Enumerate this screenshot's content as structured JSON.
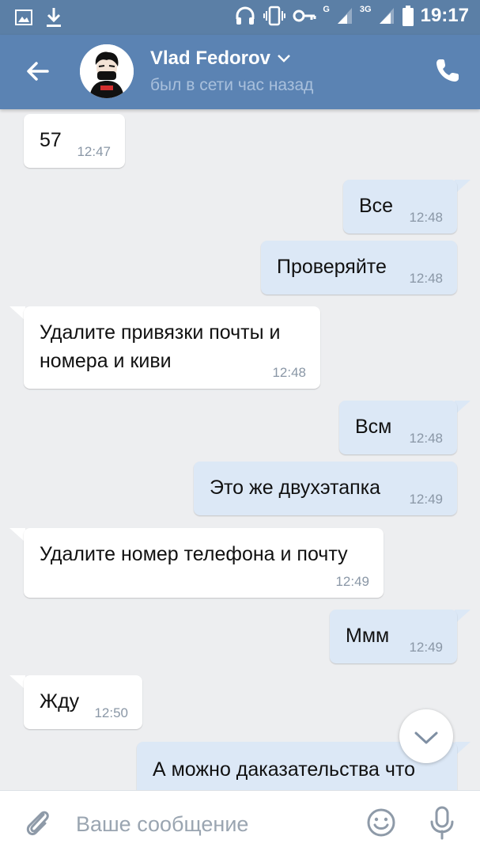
{
  "status_bar": {
    "time": "19:17",
    "network_1": "G",
    "network_2": "3G",
    "icons": [
      "image-icon",
      "download-icon",
      "headset-icon",
      "vibrate-icon",
      "key-icon",
      "signal-icon",
      "signal-icon",
      "battery-icon"
    ]
  },
  "header": {
    "contact_name": "Vlad Fedorov",
    "last_seen": "был в сети час назад",
    "icons": [
      "back-arrow-icon",
      "chevron-down-icon",
      "phone-icon"
    ]
  },
  "messages": [
    {
      "direction": "in",
      "text": "57",
      "time": "12:47"
    },
    {
      "direction": "out",
      "text": "Все",
      "time": "12:48"
    },
    {
      "direction": "out",
      "text": "Проверяйте",
      "time": "12:48"
    },
    {
      "direction": "in",
      "text_lines": [
        "Удалите привязки почты и",
        "номера и киви"
      ],
      "time": "12:48"
    },
    {
      "direction": "out",
      "text": "Всм",
      "time": "12:48"
    },
    {
      "direction": "out",
      "text": "Это же двухэтапка",
      "time": "12:49"
    },
    {
      "direction": "in",
      "text": "Удалите номер телефона и почту",
      "time": "12:49"
    },
    {
      "direction": "out",
      "text": "Ммм",
      "time": "12:49"
    },
    {
      "direction": "in",
      "text": "Жду",
      "time": "12:50"
    },
    {
      "direction": "out",
      "text": "А можно даказательства что",
      "time": ""
    }
  ],
  "composer": {
    "placeholder": "Ваше сообщение",
    "icons": [
      "paperclip-icon",
      "emoji-icon",
      "microphone-icon"
    ]
  },
  "colors": {
    "header": "#5b83b3",
    "status_bar": "#5b7fa6",
    "chat_background": "#edeef0",
    "outgoing_bubble": "#dce8f6",
    "incoming_bubble": "#ffffff"
  }
}
